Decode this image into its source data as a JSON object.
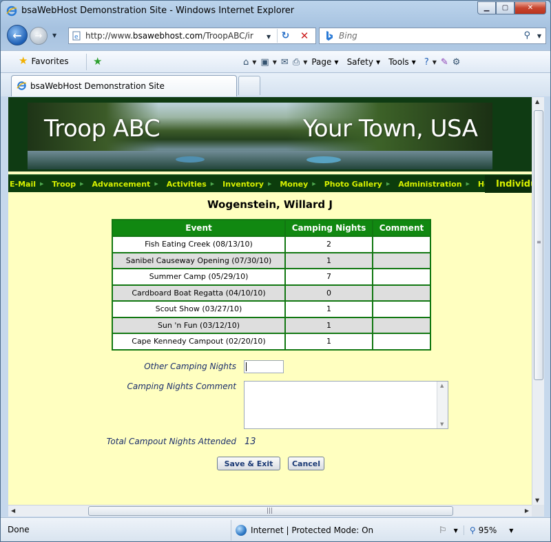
{
  "window": {
    "title": "bsaWebHost Demonstration Site - Windows Internet Explorer"
  },
  "nav": {
    "url_prefix": "http://www.",
    "url_domain": "bsawebhost.com",
    "url_suffix": "/TroopABC/ir",
    "search_placeholder": "Bing"
  },
  "favorites": {
    "label": "Favorites"
  },
  "command_bar": {
    "page": "Page",
    "safety": "Safety",
    "tools": "Tools"
  },
  "tab": {
    "label": "bsaWebHost Demonstration Site"
  },
  "banner": {
    "left_text": "Troop ABC",
    "right_text": "Your Town, USA"
  },
  "menu": {
    "items": [
      "E-Mail",
      "Troop",
      "Advancement",
      "Activities",
      "Inventory",
      "Money",
      "Photo Gallery",
      "Administration",
      "Help"
    ],
    "individual": "Individual"
  },
  "person": {
    "name": "Wogenstein, Willard J"
  },
  "table": {
    "headers": [
      "Event",
      "Camping Nights",
      "Comment"
    ],
    "rows": [
      {
        "event": "Fish Eating Creek (08/13/10)",
        "nights": "2",
        "comment": ""
      },
      {
        "event": "Sanibel Causeway Opening (07/30/10)",
        "nights": "1",
        "comment": ""
      },
      {
        "event": "Summer Camp (05/29/10)",
        "nights": "7",
        "comment": ""
      },
      {
        "event": "Cardboard Boat Regatta (04/10/10)",
        "nights": "0",
        "comment": ""
      },
      {
        "event": "Scout Show (03/27/10)",
        "nights": "1",
        "comment": ""
      },
      {
        "event": "Sun 'n Fun (03/12/10)",
        "nights": "1",
        "comment": ""
      },
      {
        "event": "Cape Kennedy Campout (02/20/10)",
        "nights": "1",
        "comment": ""
      }
    ]
  },
  "form": {
    "other_label": "Other Camping Nights",
    "other_value": "",
    "comment_label": "Camping Nights Comment",
    "comment_value": "",
    "total_label": "Total Campout Nights Attended",
    "total_value": "13",
    "save_label": "Save & Exit",
    "cancel_label": "Cancel"
  },
  "status": {
    "left": "Done",
    "zone": "Internet | Protected Mode: On",
    "zoom": "95%"
  },
  "colors": {
    "page_bg": "#ffffc0",
    "menu_bg": "#0c3d0c",
    "menu_text": "#d7f000",
    "table_header": "#118811",
    "label_text": "#1b2e6b"
  }
}
